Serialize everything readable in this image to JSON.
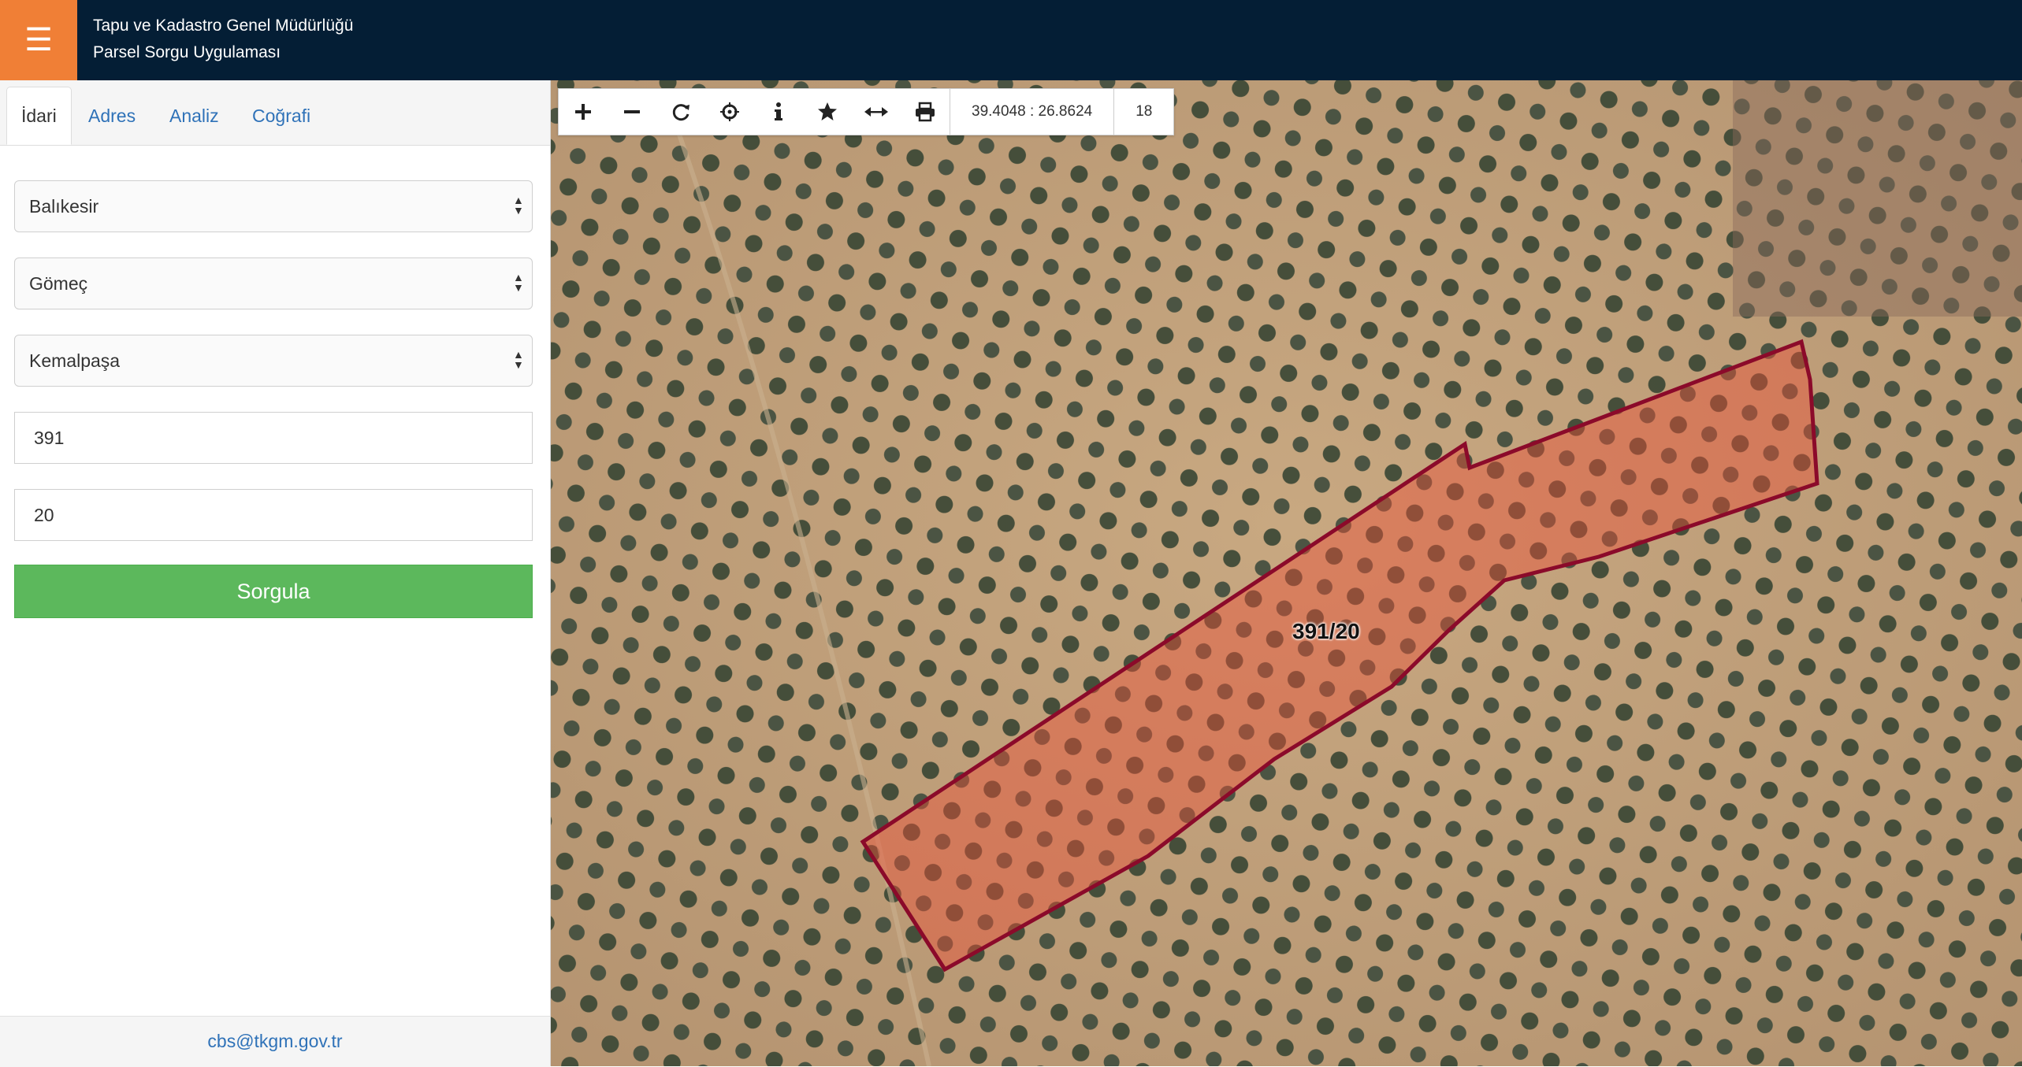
{
  "header": {
    "title_line1": "Tapu ve Kadastro Genel Müdürlüğü",
    "title_line2": "Parsel Sorgu Uygulaması",
    "menu_icon": "hamburger-icon",
    "bg_color": "#041e35",
    "accent_color": "#f07f36"
  },
  "tabs": [
    {
      "label": "İdari",
      "active": true
    },
    {
      "label": "Adres",
      "active": false
    },
    {
      "label": "Analiz",
      "active": false
    },
    {
      "label": "Coğrafi",
      "active": false
    }
  ],
  "form": {
    "province": "Balıkesir",
    "district": "Gömeç",
    "neighborhood": "Kemalpaşa",
    "block": "391",
    "parcel": "20",
    "submit_label": "Sorgula",
    "submit_color": "#5cb85c"
  },
  "footer": {
    "email": "cbs@tkgm.gov.tr"
  },
  "map": {
    "toolbar_icons": [
      "zoom-in-icon",
      "zoom-out-icon",
      "refresh-icon",
      "locate-icon",
      "info-icon",
      "star-icon",
      "measure-icon",
      "print-icon"
    ],
    "coordinates": "39.4048 : 26.8624",
    "zoom_level": "18",
    "parcel_label": "391/20",
    "parcel_outline_color": "#8b0a2a"
  }
}
